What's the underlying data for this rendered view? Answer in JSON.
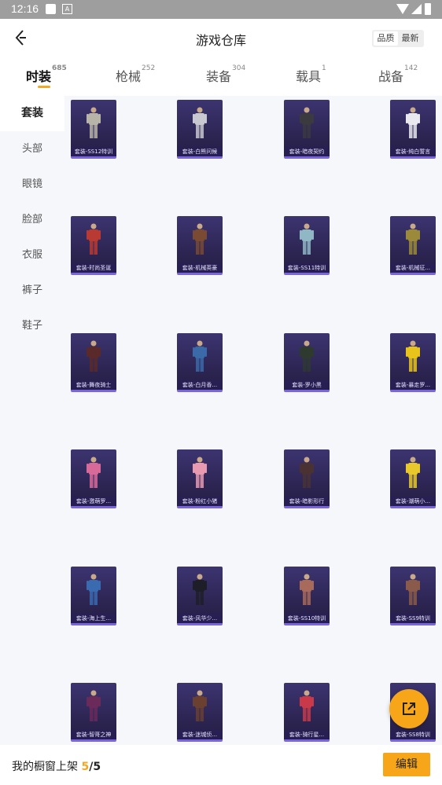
{
  "status_bar": {
    "time": "12:16",
    "notification_icon": "A"
  },
  "header": {
    "title": "游戏仓库",
    "back_icon": "chevron-left-icon",
    "sort_options": [
      "品质",
      "最新"
    ]
  },
  "tabs": [
    {
      "label": "时装",
      "count": "685",
      "active": true
    },
    {
      "label": "枪械",
      "count": "252",
      "active": false
    },
    {
      "label": "装备",
      "count": "304",
      "active": false
    },
    {
      "label": "载具",
      "count": "1",
      "active": false
    },
    {
      "label": "战备",
      "count": "142",
      "active": false
    }
  ],
  "sidebar": [
    {
      "label": "套装",
      "active": true
    },
    {
      "label": "头部",
      "active": false
    },
    {
      "label": "眼镜",
      "active": false
    },
    {
      "label": "脸部",
      "active": false
    },
    {
      "label": "衣服",
      "active": false
    },
    {
      "label": "裤子",
      "active": false
    },
    {
      "label": "鞋子",
      "active": false
    }
  ],
  "items": [
    {
      "label": "套装-SS12特训",
      "color": "#b9b4a8"
    },
    {
      "label": "套装-白熊问候",
      "color": "#c9c7cf"
    },
    {
      "label": "套装-暗夜契约",
      "color": "#3a3a3f"
    },
    {
      "label": "套装-纯白誓言",
      "color": "#e8e8ee"
    },
    {
      "label": "套装-时尚圣诞",
      "color": "#b83a33"
    },
    {
      "label": "套装-机械英豪",
      "color": "#7a4a32"
    },
    {
      "label": "套装-SS11特训",
      "color": "#8fb7c4"
    },
    {
      "label": "套装-机械征...",
      "color": "#9a8a3a"
    },
    {
      "label": "套装-舞夜骑士",
      "color": "#5a2a2a"
    },
    {
      "label": "套装-白月香...",
      "color": "#3a6aa8"
    },
    {
      "label": "套装-罗小黑",
      "color": "#2f3a2f"
    },
    {
      "label": "套装-暴走罗...",
      "color": "#e8c41a"
    },
    {
      "label": "套装-激萌罗...",
      "color": "#d86a9a"
    },
    {
      "label": "套装-粉红小猪",
      "color": "#e89ab0"
    },
    {
      "label": "套装-暗影形行",
      "color": "#4a3232"
    },
    {
      "label": "套装-潮萌小...",
      "color": "#e8c82a"
    },
    {
      "label": "套装-海上生...",
      "color": "#3a6ab0"
    },
    {
      "label": "套装-风华少...",
      "color": "#1e1e28"
    },
    {
      "label": "套装-SS10特训",
      "color": "#a86a5a"
    },
    {
      "label": "套装-SS9特训",
      "color": "#8a5a4a"
    },
    {
      "label": "套装-智哥之神",
      "color": "#6a2a5a"
    },
    {
      "label": "套装-迷城侦...",
      "color": "#6a4030"
    },
    {
      "label": "套装-骑行星...",
      "color": "#c83a4a"
    },
    {
      "label": "套装-SS8特训",
      "color": "#8a5a48"
    }
  ],
  "footer": {
    "text": "我的橱窗上架 ",
    "current": "5",
    "separator": "/",
    "total": "5",
    "edit_label": "编辑"
  },
  "fab_icon": "external-link-icon"
}
